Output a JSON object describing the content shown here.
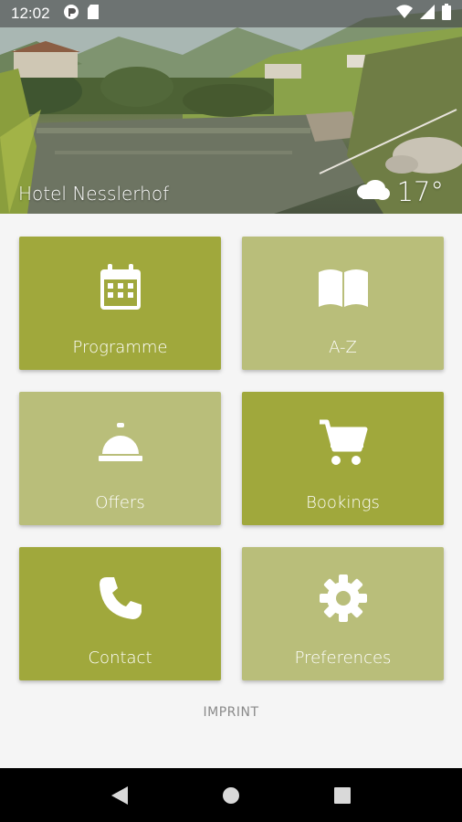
{
  "status_bar": {
    "time": "12:02",
    "icons": [
      "app-notification-icon",
      "sd-card-icon",
      "wifi-icon",
      "signal-icon",
      "battery-icon"
    ]
  },
  "header": {
    "hotel_name": "Hotel Nesslerhof",
    "temperature": "17°",
    "weather_icon": "cloud-icon"
  },
  "tiles": [
    {
      "label": "Programme",
      "icon": "calendar-icon",
      "color": "#a0a83c"
    },
    {
      "label": "A-Z",
      "icon": "book-icon",
      "color": "#b9be7a"
    },
    {
      "label": "Offers",
      "icon": "service-bell-icon",
      "color": "#b9be7a"
    },
    {
      "label": "Bookings",
      "icon": "cart-icon",
      "color": "#a0a83c"
    },
    {
      "label": "Contact",
      "icon": "phone-icon",
      "color": "#a0a83c"
    },
    {
      "label": "Preferences",
      "icon": "gear-icon",
      "color": "#b9be7a"
    }
  ],
  "footer": {
    "imprint_label": "IMPRINT"
  },
  "nav_bar": {
    "buttons": [
      "back-icon",
      "home-icon",
      "recents-icon"
    ]
  },
  "colors": {
    "tile_dark": "#a0a83c",
    "tile_light": "#b9be7a",
    "background": "#f5f5f5"
  }
}
